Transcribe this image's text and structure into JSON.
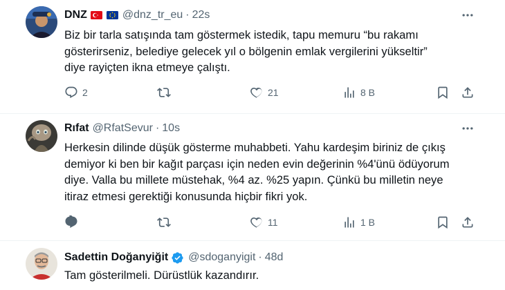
{
  "tweets": [
    {
      "name": "DNZ",
      "handle": "@dnz_tr_eu",
      "time": "22s",
      "flags": [
        "turkey-flag",
        "eu-flag"
      ],
      "lines": [
        "Biz bir tarla satışında tam göstermek istedik, tapu memuru “bu rakamı",
        "gösterirseniz, belediye gelecek yıl o bölgenin emlak vergilerini yükseltir”",
        "diye rayiçten ikna etmeye çalıştı."
      ],
      "replies": "2",
      "reposts": "",
      "likes": "21",
      "views": "8 B"
    },
    {
      "name": "Rıfat",
      "handle": "@RfatSevur",
      "time": "10s",
      "lines": [
        "Herkesin dilinde düşük gösterme muhabbeti. Yahu kardeşim biriniz de çıkış",
        "demiyor ki ben bir kağıt parçası için neden evin değerinin %4'ünü ödüyorum",
        "diye. Valla bu millete müstehak, %4 az. %25 yapın. Çünkü bu milletin neye",
        "itiraz etmesi gerektiği konusunda hiçbir fikri yok."
      ],
      "replies": "",
      "reposts": "",
      "likes": "11",
      "views": "1 B"
    },
    {
      "name": "Sadettin Doğanyiğit",
      "handle": "@sdoganyigit",
      "time": "48d",
      "verified": true,
      "lines": [
        "Tam gösterilmeli. Dürüstlük kazandırır."
      ]
    }
  ],
  "colors": {
    "text": "#0f1419",
    "secondary": "#536471",
    "verified": "#1d9bf0",
    "divider": "#eff3f4"
  }
}
